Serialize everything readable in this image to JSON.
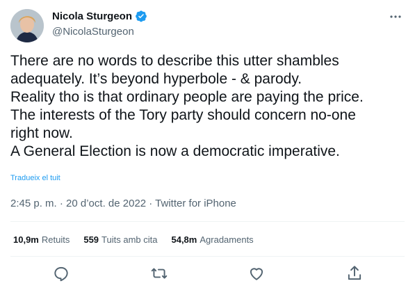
{
  "author": {
    "name": "Nicola Sturgeon",
    "handle": "@NicolaSturgeon",
    "verified": true
  },
  "tweet": {
    "lines": [
      "There are no words to describe this utter shambles",
      "adequately. It’s beyond hyperbole - & parody.",
      "Reality tho is that ordinary people are paying the price.",
      "The interests of the Tory party should concern no-one",
      "right now.",
      "A General Election is now a democratic imperative."
    ],
    "translate_label": "Tradueix el tuit",
    "timestamp": "2:45 p. m. · 20 d’oct. de 2022 · Twitter for iPhone"
  },
  "stats": {
    "retweets_value": "10,9m",
    "retweets_label": "Retuits",
    "quotes_value": "559",
    "quotes_label": "Tuits amb cita",
    "likes_value": "54,8m",
    "likes_label": "Agradaments"
  },
  "icons": {
    "more": "more-icon",
    "reply": "reply-icon",
    "retweet": "retweet-icon",
    "like": "heart-icon",
    "share": "share-icon",
    "verified": "verified-badge-icon"
  },
  "colors": {
    "accent": "#1d9bf0",
    "secondary_text": "#536471",
    "primary_text": "#0f1419",
    "divider": "#eff3f4"
  }
}
